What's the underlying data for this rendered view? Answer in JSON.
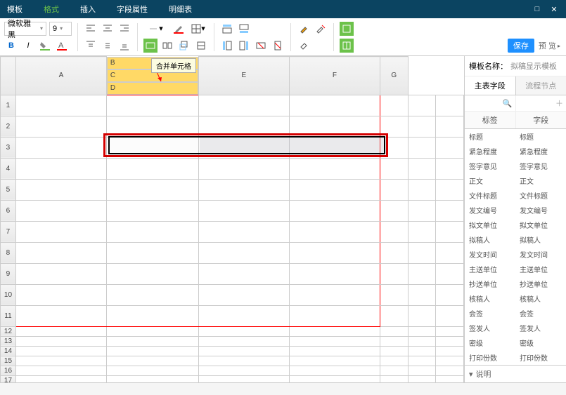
{
  "menu": {
    "template": "模板",
    "format": "格式",
    "insert": "插入",
    "fieldprops": "字段属性",
    "detailtable": "明细表"
  },
  "toolbar": {
    "font": "微软雅黑",
    "size": "9",
    "save": "保存",
    "preview": "预 览",
    "tooltip": "合并单元格"
  },
  "template_label": "模板名称：",
  "template_name": "拟稿显示模板",
  "tabs": {
    "main": "主表字段",
    "process": "流程节点"
  },
  "cols": {
    "label": "标签",
    "field": "字段"
  },
  "fields": [
    {
      "l": "标题",
      "f": "标题"
    },
    {
      "l": "紧急程度",
      "f": "紧急程度"
    },
    {
      "l": "签字意见",
      "f": "签字意见"
    },
    {
      "l": "正文",
      "f": "正文"
    },
    {
      "l": "文件标题",
      "f": "文件标题"
    },
    {
      "l": "发文编号",
      "f": "发文编号"
    },
    {
      "l": "拟文单位",
      "f": "拟文单位"
    },
    {
      "l": "拟稿人",
      "f": "拟稿人"
    },
    {
      "l": "发文时间",
      "f": "发文时间"
    },
    {
      "l": "主送单位",
      "f": "主送单位"
    },
    {
      "l": "抄送单位",
      "f": "抄送单位"
    },
    {
      "l": "核稿人",
      "f": "核稿人"
    },
    {
      "l": "会签",
      "f": "会签"
    },
    {
      "l": "签发人",
      "f": "签发人"
    },
    {
      "l": "密级",
      "f": "密级"
    },
    {
      "l": "打印份数",
      "f": "打印份数"
    }
  ],
  "footer": "说明",
  "columns": [
    "",
    "A",
    "B",
    "C",
    "D",
    "E",
    "F",
    "G"
  ],
  "rows_tall": 11,
  "rows_short": 6
}
